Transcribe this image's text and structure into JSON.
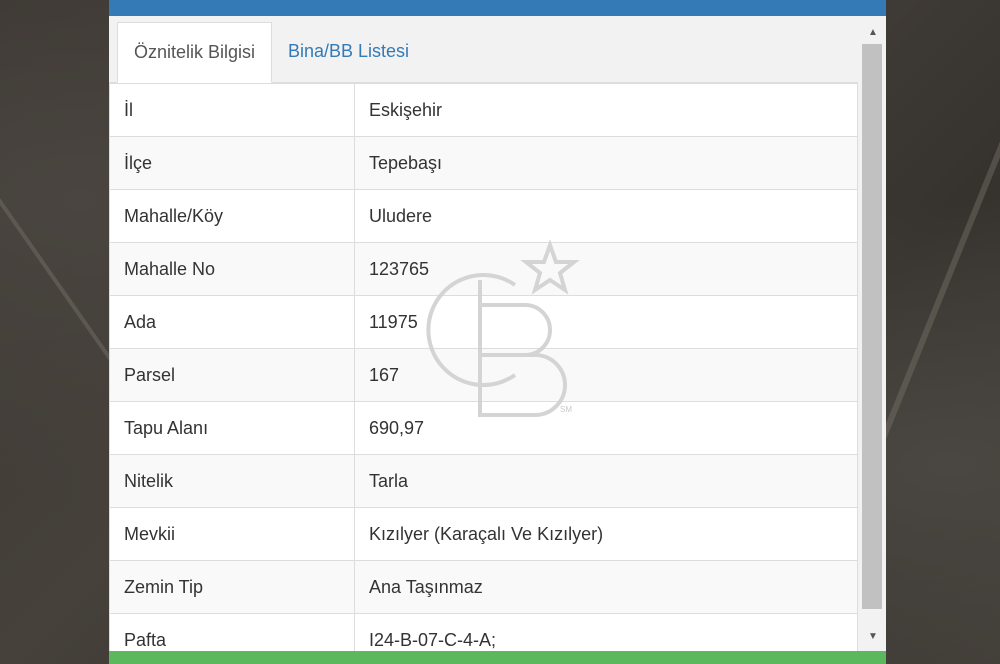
{
  "tabs": [
    {
      "label": "Öznitelik Bilgisi",
      "active": true
    },
    {
      "label": "Bina/BB Listesi",
      "active": false
    }
  ],
  "rows": [
    {
      "key": "İl",
      "value": "Eskişehir"
    },
    {
      "key": "İlçe",
      "value": "Tepebaşı"
    },
    {
      "key": "Mahalle/Köy",
      "value": "Uludere"
    },
    {
      "key": "Mahalle No",
      "value": "123765"
    },
    {
      "key": "Ada",
      "value": "11975"
    },
    {
      "key": "Parsel",
      "value": "167"
    },
    {
      "key": "Tapu Alanı",
      "value": "690,97"
    },
    {
      "key": "Nitelik",
      "value": "Tarla"
    },
    {
      "key": "Mevkii",
      "value": "Kızılyer (Karaçalı Ve Kızılyer)"
    },
    {
      "key": "Zemin Tip",
      "value": "Ana Taşınmaz"
    },
    {
      "key": "Pafta",
      "value": "I24-B-07-C-4-A;"
    }
  ],
  "watermark": {
    "mark": "SM"
  },
  "colors": {
    "header": "#337ab7",
    "footer": "#5cb85c",
    "link": "#337ab7"
  }
}
